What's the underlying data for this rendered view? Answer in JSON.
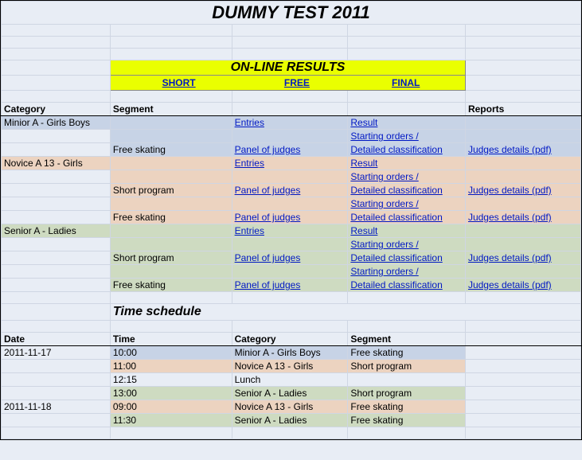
{
  "title": "DUMMY TEST 2011",
  "online_results": {
    "heading": "ON-LINE RESULTS",
    "short": "SHORT",
    "free": "FREE",
    "final": "FINAL"
  },
  "results_header": {
    "category": "Category",
    "segment": "Segment",
    "reports": "Reports"
  },
  "categories": [
    {
      "name": "Minior A - Girls Boys",
      "color": "c-blue",
      "rows": [
        {
          "segment": "",
          "c3": {
            "t": "Entries",
            "l": true
          },
          "c4": {
            "t": "Result",
            "l": true
          },
          "rep": {
            "t": "",
            "l": false
          }
        },
        {
          "segment": "",
          "c3": {
            "t": "",
            "l": false
          },
          "c4": {
            "t": "Starting orders /",
            "l": true
          },
          "rep": {
            "t": "",
            "l": false
          }
        },
        {
          "segment": "Free skating",
          "c3": {
            "t": "Panel of judges",
            "l": true
          },
          "c4": {
            "t": "Detailed classification",
            "l": true
          },
          "rep": {
            "t": "Judges details (pdf)",
            "l": true
          }
        }
      ]
    },
    {
      "name": "Novice A 13 - Girls",
      "color": "c-peach",
      "rows": [
        {
          "segment": "",
          "c3": {
            "t": "Entries",
            "l": true
          },
          "c4": {
            "t": "Result",
            "l": true
          },
          "rep": {
            "t": "",
            "l": false
          }
        },
        {
          "segment": "",
          "c3": {
            "t": "",
            "l": false
          },
          "c4": {
            "t": "Starting orders /",
            "l": true
          },
          "rep": {
            "t": "",
            "l": false
          }
        },
        {
          "segment": "Short program",
          "c3": {
            "t": "Panel of judges",
            "l": true
          },
          "c4": {
            "t": "Detailed classification",
            "l": true
          },
          "rep": {
            "t": "Judges details (pdf)",
            "l": true
          }
        },
        {
          "segment": "",
          "c3": {
            "t": "",
            "l": false
          },
          "c4": {
            "t": "Starting orders /",
            "l": true
          },
          "rep": {
            "t": "",
            "l": false
          }
        },
        {
          "segment": "Free skating",
          "c3": {
            "t": "Panel of judges",
            "l": true
          },
          "c4": {
            "t": "Detailed classification",
            "l": true
          },
          "rep": {
            "t": "Judges details (pdf)",
            "l": true
          }
        }
      ]
    },
    {
      "name": "Senior A - Ladies",
      "color": "c-green",
      "rows": [
        {
          "segment": "",
          "c3": {
            "t": "Entries",
            "l": true
          },
          "c4": {
            "t": "Result",
            "l": true
          },
          "rep": {
            "t": "",
            "l": false
          }
        },
        {
          "segment": "",
          "c3": {
            "t": "",
            "l": false
          },
          "c4": {
            "t": "Starting orders /",
            "l": true
          },
          "rep": {
            "t": "",
            "l": false
          }
        },
        {
          "segment": "Short program",
          "c3": {
            "t": "Panel of judges",
            "l": true
          },
          "c4": {
            "t": "Detailed classification",
            "l": true
          },
          "rep": {
            "t": "Judges details (pdf)",
            "l": true
          }
        },
        {
          "segment": "",
          "c3": {
            "t": "",
            "l": false
          },
          "c4": {
            "t": "Starting orders /",
            "l": true
          },
          "rep": {
            "t": "",
            "l": false
          }
        },
        {
          "segment": "Free skating",
          "c3": {
            "t": "Panel of judges",
            "l": true
          },
          "c4": {
            "t": "Detailed classification",
            "l": true
          },
          "rep": {
            "t": "Judges details (pdf)",
            "l": true
          }
        }
      ]
    }
  ],
  "schedule": {
    "heading": "Time schedule",
    "header": {
      "date": "Date",
      "time": "Time",
      "category": "Category",
      "segment": "Segment"
    },
    "rows": [
      {
        "date": "2011-11-17",
        "time": "10:00",
        "category": "Minior A - Girls Boys",
        "segment": "Free skating",
        "color": "c-blue"
      },
      {
        "date": "",
        "time": "11:00",
        "category": "Novice A 13 - Girls",
        "segment": "Short program",
        "color": "c-peach"
      },
      {
        "date": "",
        "time": "12:15",
        "category": "Lunch",
        "segment": "",
        "color": "c-plain"
      },
      {
        "date": "",
        "time": "13:00",
        "category": "Senior A - Ladies",
        "segment": "Short program",
        "color": "c-green"
      },
      {
        "date": "2011-11-18",
        "time": "09:00",
        "category": "Novice A 13 - Girls",
        "segment": "Free skating",
        "color": "c-peach"
      },
      {
        "date": "",
        "time": "11:30",
        "category": "Senior A - Ladies",
        "segment": "Free skating",
        "color": "c-green"
      }
    ]
  }
}
